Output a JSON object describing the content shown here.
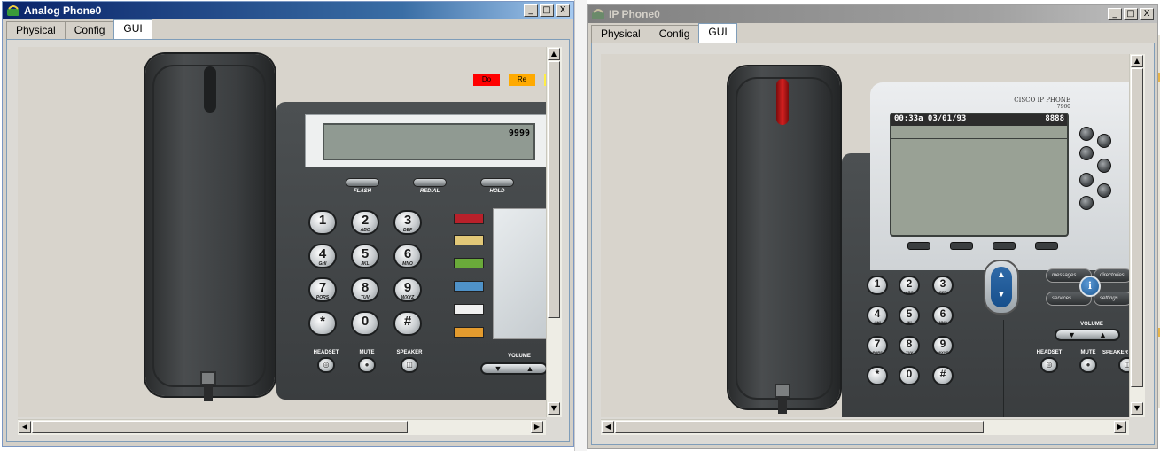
{
  "desktop": {},
  "windows": [
    {
      "title": "Analog Phone0",
      "state": "active",
      "controls": {
        "minimize": "_",
        "maximize": "□",
        "close": "X"
      },
      "tabs": [
        {
          "label": "Physical",
          "selected": false
        },
        {
          "label": "Config",
          "selected": false
        },
        {
          "label": "GUI",
          "selected": true
        }
      ],
      "phone": {
        "indicators": [
          {
            "label": "Do",
            "color": "#ff0000"
          },
          {
            "label": "Re",
            "color": "#ffaa00"
          }
        ],
        "display_number": "9999",
        "function_keys": [
          "FLASH",
          "REDIAL",
          "HOLD"
        ],
        "keypad": [
          {
            "digit": "1",
            "letters": ""
          },
          {
            "digit": "2",
            "letters": "ABC"
          },
          {
            "digit": "3",
            "letters": "DEF"
          },
          {
            "digit": "4",
            "letters": "GHI"
          },
          {
            "digit": "5",
            "letters": "JKL"
          },
          {
            "digit": "6",
            "letters": "MNO"
          },
          {
            "digit": "7",
            "letters": "PQRS"
          },
          {
            "digit": "8",
            "letters": "TUV"
          },
          {
            "digit": "9",
            "letters": "WXYZ"
          },
          {
            "digit": "*",
            "letters": ""
          },
          {
            "digit": "0",
            "letters": ""
          },
          {
            "digit": "#",
            "letters": ""
          }
        ],
        "line_button_colors": [
          "#b8202a",
          "#e2c878",
          "#6aaa3a",
          "#4f92c8",
          "#f0f0f0",
          "#e39b2e"
        ],
        "bottom_buttons": [
          "HEADSET",
          "MUTE",
          "SPEAKER"
        ],
        "volume_label": "VOLUME",
        "volume_arrows": [
          "▼",
          "▲"
        ]
      }
    },
    {
      "title": "IP Phone0",
      "state": "inactive",
      "controls": {
        "minimize": "_",
        "maximize": "□",
        "close": "X"
      },
      "tabs": [
        {
          "label": "Physical",
          "selected": false
        },
        {
          "label": "Config",
          "selected": false
        },
        {
          "label": "GUI",
          "selected": true
        }
      ],
      "phone": {
        "brand": "CISCO IP PHONE",
        "model": "7960",
        "status_time": "00:33a 03/01/93",
        "status_number": "8888",
        "keypad": [
          {
            "digit": "1",
            "letters": ""
          },
          {
            "digit": "2",
            "letters": "ABC"
          },
          {
            "digit": "3",
            "letters": "DEF"
          },
          {
            "digit": "4",
            "letters": "GHI"
          },
          {
            "digit": "5",
            "letters": "JKL"
          },
          {
            "digit": "6",
            "letters": "MNO"
          },
          {
            "digit": "7",
            "letters": "PQRS"
          },
          {
            "digit": "8",
            "letters": "TUV"
          },
          {
            "digit": "9",
            "letters": "WXYZ"
          },
          {
            "digit": "*",
            "letters": ""
          },
          {
            "digit": "0",
            "letters": ""
          },
          {
            "digit": "#",
            "letters": ""
          }
        ],
        "function_buttons": [
          "messages",
          "directories",
          "services",
          "settings"
        ],
        "info_label": "i",
        "volume_label": "VOLUME",
        "volume_arrows": [
          "▼",
          "▲"
        ],
        "bottom_buttons": [
          "HEADSET",
          "MUTE",
          "SPEAKER"
        ],
        "nav_arrows": [
          "▲",
          "▼"
        ]
      }
    }
  ]
}
